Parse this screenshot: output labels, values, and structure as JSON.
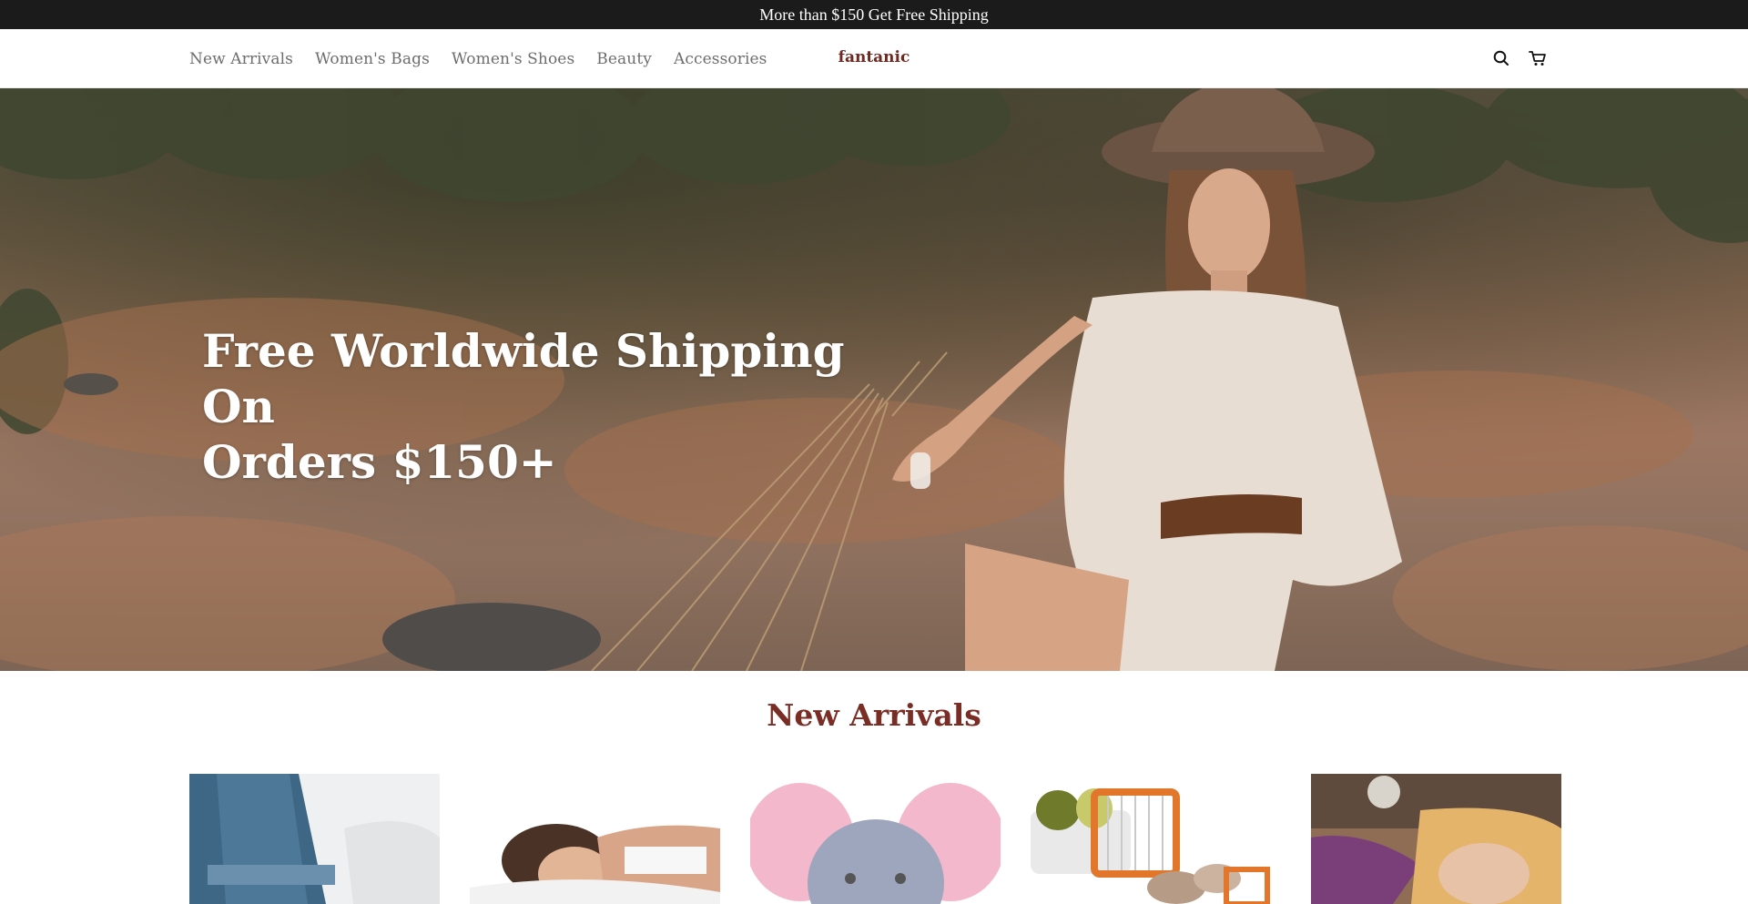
{
  "announcement": {
    "text": "More than $150 Get Free Shipping"
  },
  "header": {
    "nav": [
      {
        "label": "New Arrivals"
      },
      {
        "label": "Women's Bags"
      },
      {
        "label": "Women's Shoes"
      },
      {
        "label": "Beauty"
      },
      {
        "label": "Accessories"
      }
    ],
    "logo": "fantanic",
    "icons": [
      "search-icon",
      "cart-icon"
    ]
  },
  "hero": {
    "heading_line1": "Free Worldwide Shipping On",
    "heading_line2": "Orders $150+"
  },
  "new_arrivals": {
    "title": "New Arrivals",
    "products": [
      {
        "image": "jeans-and-shoes-product-image"
      },
      {
        "image": "sleeping-woman-pillow-product-image"
      },
      {
        "image": "pink-elephant-plush-product-image"
      },
      {
        "image": "vegetable-slicer-product-image"
      },
      {
        "image": "sleeping-woman-mouthpiece-product-image"
      }
    ]
  },
  "colors": {
    "announcement_bg": "#1b1b1b",
    "brand": "#6e2a22",
    "section_title": "#7a2d25",
    "nav_text": "#6d6d6d"
  }
}
